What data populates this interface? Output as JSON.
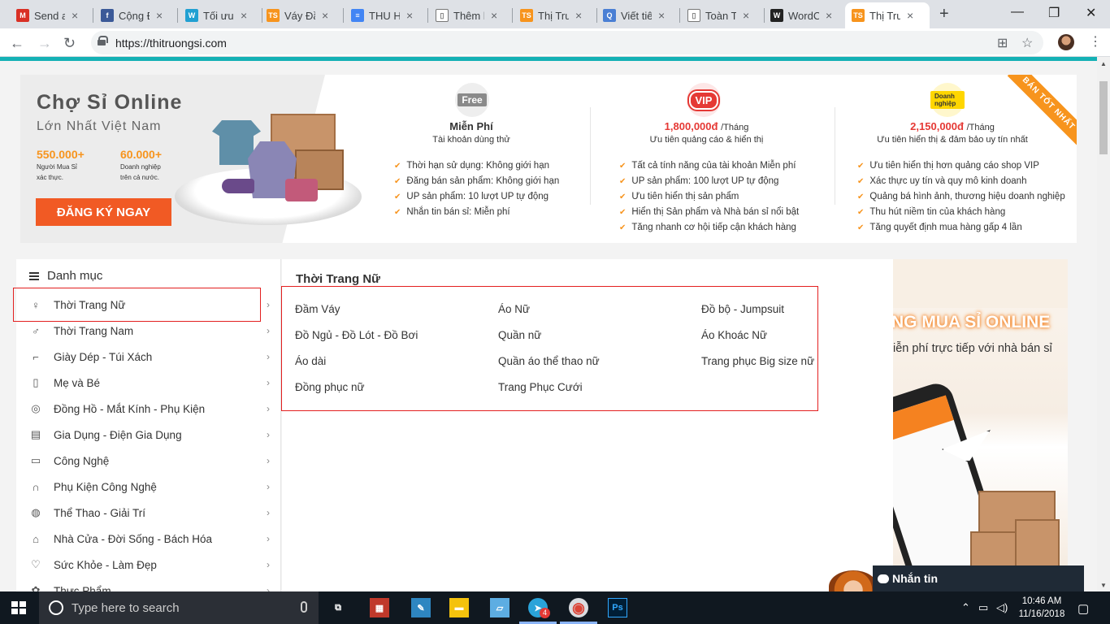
{
  "browser": {
    "tabs": [
      {
        "title": "Send a",
        "icon": "gmail-icon",
        "color": "#d93025",
        "glyph": "M"
      },
      {
        "title": "Cộng Đ",
        "icon": "facebook-icon",
        "color": "#3b5998",
        "glyph": "f"
      },
      {
        "title": "Tối ưu",
        "icon": "wordpress-icon",
        "color": "#21a0d2",
        "glyph": "W"
      },
      {
        "title": "Váy Đầ",
        "icon": "ts-logo-icon",
        "color": "#f7941d",
        "glyph": "TS"
      },
      {
        "title": "THU H",
        "icon": "docs-icon",
        "color": "#4285f4",
        "glyph": "≡"
      },
      {
        "title": "Thêm b",
        "icon": "page-icon",
        "color": "#ffffff",
        "glyph": "▯"
      },
      {
        "title": "Thị Trư",
        "icon": "ts-logo-icon",
        "color": "#f7941d",
        "glyph": "TS"
      },
      {
        "title": "Viết tiê",
        "icon": "search-tool-icon",
        "color": "#4a7fd4",
        "glyph": "Q"
      },
      {
        "title": "Toàn T",
        "icon": "page-icon",
        "color": "#ffffff",
        "glyph": "▯"
      },
      {
        "title": "WordC",
        "icon": "wordcounter-icon",
        "color": "#222222",
        "glyph": "W"
      },
      {
        "title": "Thị Trư",
        "icon": "ts-logo-icon",
        "color": "#f7941d",
        "glyph": "TS",
        "active": true
      }
    ],
    "close_glyph": "×",
    "new_tab_glyph": "+",
    "url": "https://thitruongsi.com",
    "window_controls": {
      "minimize": "—",
      "maximize": "❐",
      "close": "✕"
    },
    "nav": {
      "back": "←",
      "forward": "→",
      "reload": "↻"
    },
    "icons": {
      "translate": "⊞",
      "star": "☆",
      "menu": "⋮"
    }
  },
  "banner": {
    "title": "Chợ Sỉ Online",
    "subtitle": "Lớn Nhất Việt Nam",
    "stats": [
      {
        "number": "550.000+",
        "desc_1": "Người Mua Sỉ",
        "desc_2": "xác thực."
      },
      {
        "number": "60.000+",
        "desc_1": "Doanh nghiệp",
        "desc_2": "trên cả nước."
      }
    ],
    "cta_label": "ĐĂNG KÝ NGAY",
    "ribbon": "BÁN TỐT NHẤT",
    "plans": [
      {
        "badge": "Free",
        "name": "Miễn Phí",
        "price": "",
        "unit": "",
        "desc": "Tài khoản dùng thử",
        "features": [
          "Thời hạn sử dụng: Không giới hạn",
          "Đăng bán sản phẩm: Không giới hạn",
          "UP sản phẩm: 10 lượt UP tự động",
          "Nhắn tin bán sỉ: Miễn phí"
        ]
      },
      {
        "badge": "VIP",
        "name": "",
        "price": "1,800,000đ",
        "unit": "/Tháng",
        "desc": "Ưu tiên quảng cáo & hiển thị",
        "features": [
          "Tất cả tính năng của tài khoản Miễn phí",
          "UP sản phẩm: 100 lượt UP tự động",
          "Ưu tiên hiển thị sản phẩm",
          "Hiển thị Sản phẩm và Nhà bán sỉ nổi bật",
          "Tăng nhanh cơ hội tiếp cận khách hàng"
        ]
      },
      {
        "badge": "Doanh nghiệp",
        "name": "",
        "price": "2,150,000đ",
        "unit": "/Tháng",
        "desc": "Ưu tiên hiển thị & đảm bảo uy tín nhất",
        "features": [
          "Ưu tiên hiển thị hơn quảng cáo shop VIP",
          "Xác thực uy tín và quy mô kinh doanh",
          "Quảng bá hình ảnh, thương hiệu doanh nghiệp",
          "Thu hút niềm tin của khách hàng",
          "Tăng quyết định mua hàng gấp 4 lần"
        ]
      }
    ]
  },
  "sidebar": {
    "heading": "Danh mục",
    "items": [
      {
        "label": "Thời Trang Nữ",
        "icon": "dress-icon",
        "glyph": "♀"
      },
      {
        "label": "Thời Trang Nam",
        "icon": "shirt-icon",
        "glyph": "♂"
      },
      {
        "label": "Giày Dép - Túi Xách",
        "icon": "shoe-icon",
        "glyph": "⌐"
      },
      {
        "label": "Mẹ và Bé",
        "icon": "baby-bottle-icon",
        "glyph": "▯"
      },
      {
        "label": "Đồng Hồ - Mắt Kính - Phụ Kiện",
        "icon": "watch-icon",
        "glyph": "◎"
      },
      {
        "label": "Gia Dụng - Điện Gia Dụng",
        "icon": "appliance-icon",
        "glyph": "▤"
      },
      {
        "label": "Công Nghệ",
        "icon": "monitor-icon",
        "glyph": "▭"
      },
      {
        "label": "Phụ Kiện Công Nghệ",
        "icon": "headphones-icon",
        "glyph": "∩"
      },
      {
        "label": "Thể Thao - Giải Trí",
        "icon": "ball-icon",
        "glyph": "◍"
      },
      {
        "label": "Nhà Cửa - Đời Sống - Bách Hóa",
        "icon": "house-icon",
        "glyph": "⌂"
      },
      {
        "label": "Sức Khỏe - Làm Đẹp",
        "icon": "heart-pulse-icon",
        "glyph": "♡"
      },
      {
        "label": "Thực Phẩm",
        "icon": "food-icon",
        "glyph": "✿"
      }
    ],
    "chevron": "›"
  },
  "panel": {
    "title": "Thời Trang Nữ",
    "columns": [
      [
        "Đầm Váy",
        "Đồ Ngủ - Đồ Lót - Đồ Bơi",
        "Áo dài",
        "Đồng phục nữ"
      ],
      [
        "Áo Nữ",
        "Quần nữ",
        "Quần áo thể thao nữ",
        "Trang Phục Cưới"
      ],
      [
        "Đồ bộ - Jumpsuit",
        "Áo Khoác Nữ",
        "Trang phục Big size nữ"
      ]
    ]
  },
  "promo": {
    "heading": "NG MUA SỈ ONLINE",
    "sub": "iễn phí trực tiếp với nhà bán sỉ"
  },
  "chat": {
    "label": "Nhắn tin"
  },
  "taskbar": {
    "search_placeholder": "Type here to search",
    "time": "10:46 AM",
    "date": "11/16/2018",
    "badge_count": "4",
    "apps": [
      {
        "name": "task-view-icon",
        "glyph": "⧉"
      },
      {
        "name": "store-app-icon",
        "glyph": "▦"
      },
      {
        "name": "paint-app-icon",
        "glyph": "✎"
      },
      {
        "name": "file-explorer-icon",
        "glyph": "▬"
      },
      {
        "name": "notepad-app-icon",
        "glyph": "▱"
      },
      {
        "name": "telegram-icon",
        "glyph": "➤"
      },
      {
        "name": "chrome-icon",
        "glyph": "◉"
      },
      {
        "name": "photoshop-icon",
        "glyph": "Ps"
      }
    ],
    "tray": {
      "up": "⌃",
      "network": "▭",
      "volume": "◁)",
      "notification": "▢"
    }
  }
}
